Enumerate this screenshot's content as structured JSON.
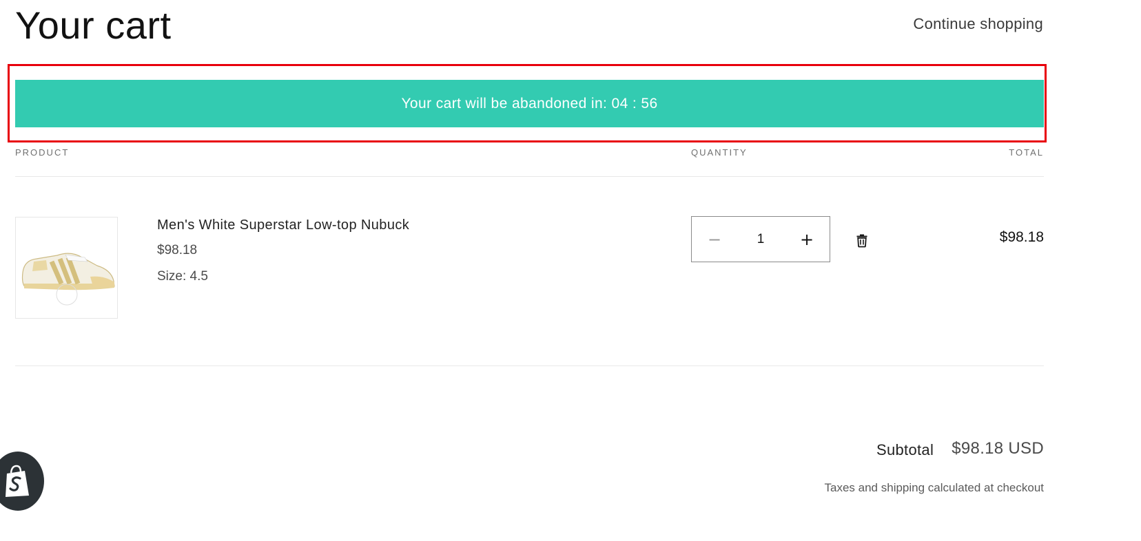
{
  "header": {
    "title": "Your cart",
    "continue_label": "Continue shopping"
  },
  "banner": {
    "text": "Your cart will be abandoned in: 04 : 56",
    "bg_color": "#33cbb1",
    "highlight_color": "#e8000b"
  },
  "table": {
    "headers": {
      "product": "PRODUCT",
      "quantity": "QUANTITY",
      "total": "TOTAL"
    }
  },
  "items": [
    {
      "name": "Men's White Superstar Low-top Nubuck",
      "price": "$98.18",
      "size": "Size: 4.5",
      "quantity": "1",
      "line_total": "$98.18",
      "image_icon": "sneaker-image"
    }
  ],
  "summary": {
    "subtotal_label": "Subtotal",
    "subtotal_value": "$98.18 USD",
    "tax_note": "Taxes and shipping calculated at checkout"
  },
  "icons": {
    "minus": "−",
    "plus": "+",
    "delete": "trash-icon",
    "badge": "shopify-bag-icon"
  }
}
